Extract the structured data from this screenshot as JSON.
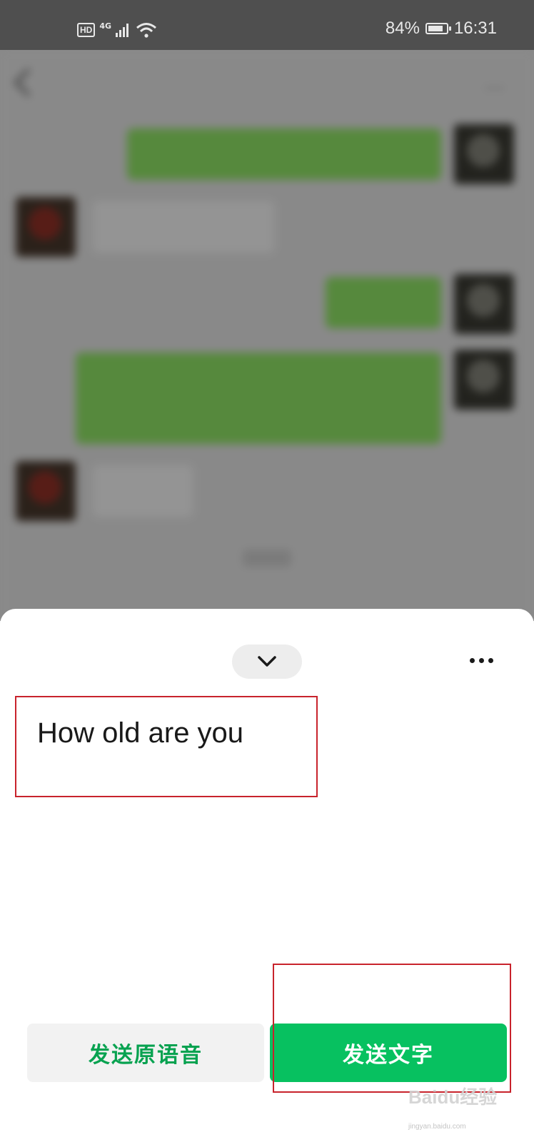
{
  "status_bar": {
    "hd": "HD",
    "network": "4G",
    "battery": "84%",
    "battery_level": 0.84,
    "time": "16:31"
  },
  "chat": {
    "title": "",
    "messages": [
      {
        "from": "me",
        "text": ""
      },
      {
        "from": "friend",
        "text": ""
      },
      {
        "from": "me",
        "text": ""
      },
      {
        "from": "me",
        "text": ""
      },
      {
        "from": "friend",
        "text": ""
      }
    ]
  },
  "sheet": {
    "recognized_text": "How old are you",
    "send_voice_label": "发送原语音",
    "send_text_label": "发送文字"
  },
  "watermark": {
    "brand": "Baidu经验",
    "url": "jingyan.baidu.com"
  },
  "colors": {
    "accent": "#07c160",
    "accent_text": "#07a250",
    "annotation": "#c8232c",
    "status_bar": "#4f4f4f"
  },
  "icons": [
    "hd-icon",
    "signal-icon",
    "wifi-icon",
    "battery-icon",
    "back-icon",
    "chevron-down-icon",
    "more-icon"
  ]
}
